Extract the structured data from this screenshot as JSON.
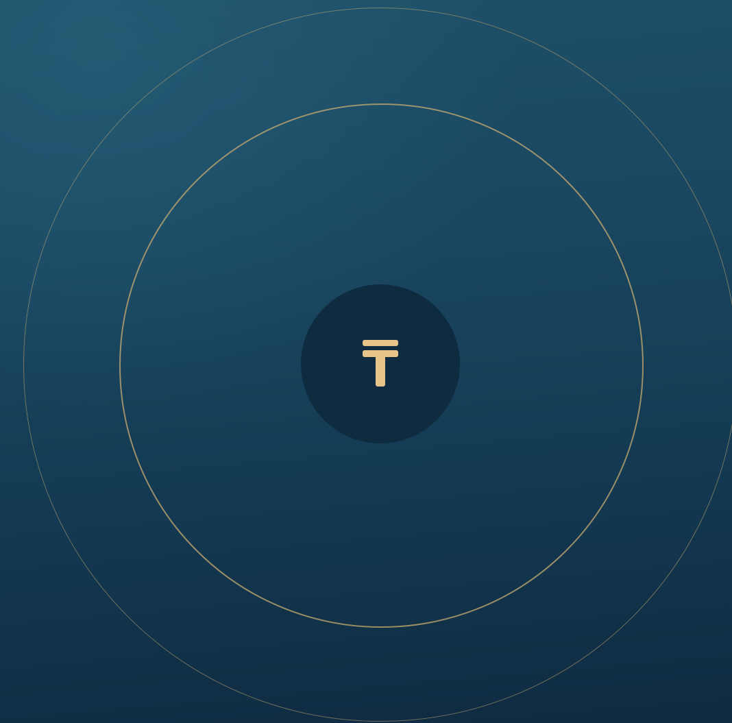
{
  "scene": {
    "colors": {
      "background_top": "#1f5068",
      "background_bottom": "#0e2a40",
      "ring": "#c8ac70",
      "disc": "#0e2b40",
      "glyph": "#e7c48a"
    },
    "emblem": {
      "icon": "tenge-currency-icon"
    }
  }
}
